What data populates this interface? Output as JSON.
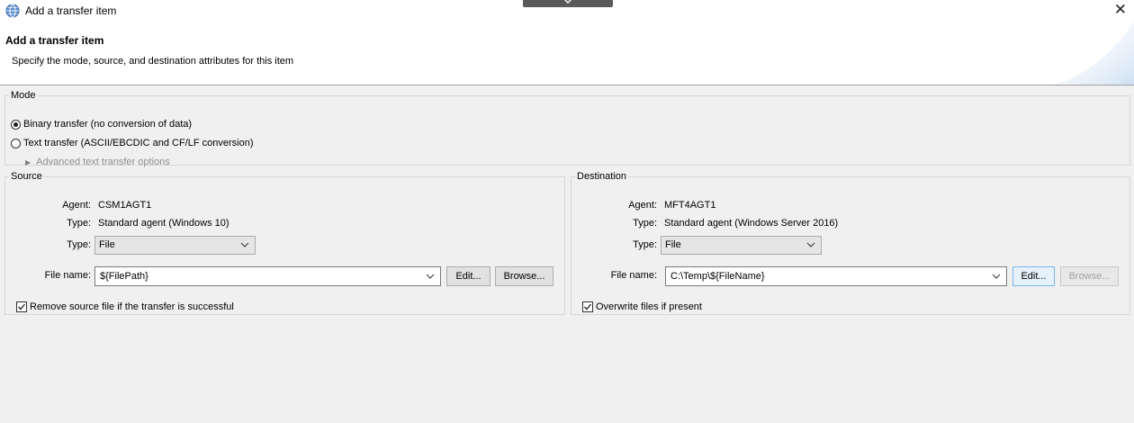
{
  "window": {
    "title": "Add a transfer item",
    "close_glyph": "✕"
  },
  "header": {
    "title": "Add a transfer item",
    "description": "Specify the mode, source, and destination attributes for this item"
  },
  "mode": {
    "legend": "Mode",
    "options": [
      {
        "label": "Binary transfer (no conversion of data)",
        "selected": true
      },
      {
        "label": "Text transfer (ASCII/EBCDIC and CF/LF conversion)",
        "selected": false
      }
    ],
    "advanced_label": "Advanced text transfer options"
  },
  "source": {
    "legend": "Source",
    "agent_label": "Agent:",
    "agent_value": "CSM1AGT1",
    "type_label": "Type:",
    "type_value": "Standard agent (Windows 10)",
    "type_select_label": "Type:",
    "type_select_value": "File",
    "file_label": "File name:",
    "file_value": "${FilePath}",
    "edit_label": "Edit...",
    "browse_label": "Browse...",
    "checkbox_label": "Remove source file if the transfer is successful",
    "checkbox_checked": true
  },
  "destination": {
    "legend": "Destination",
    "agent_label": "Agent:",
    "agent_value": "MFT4AGT1",
    "type_label": "Type:",
    "type_value": "Standard agent (Windows Server 2016)",
    "type_select_label": "Type:",
    "type_select_value": "File",
    "file_label": "File name:",
    "file_value": "C:\\Temp\\${FileName}",
    "edit_label": "Edit...",
    "browse_label": "Browse...",
    "browse_enabled": false,
    "checkbox_label": "Overwrite files if present",
    "checkbox_checked": true
  },
  "icons": {
    "app": "globe-icon",
    "close": "close-icon",
    "dropdown": "chevron-down-icon",
    "expand": "triangle-right-icon",
    "check": "checkmark-icon"
  },
  "colors": {
    "background": "#f0f0f0",
    "header_background": "#ffffff",
    "disabled_text": "#8f8f8f",
    "focus_border": "#7eb4ea"
  }
}
